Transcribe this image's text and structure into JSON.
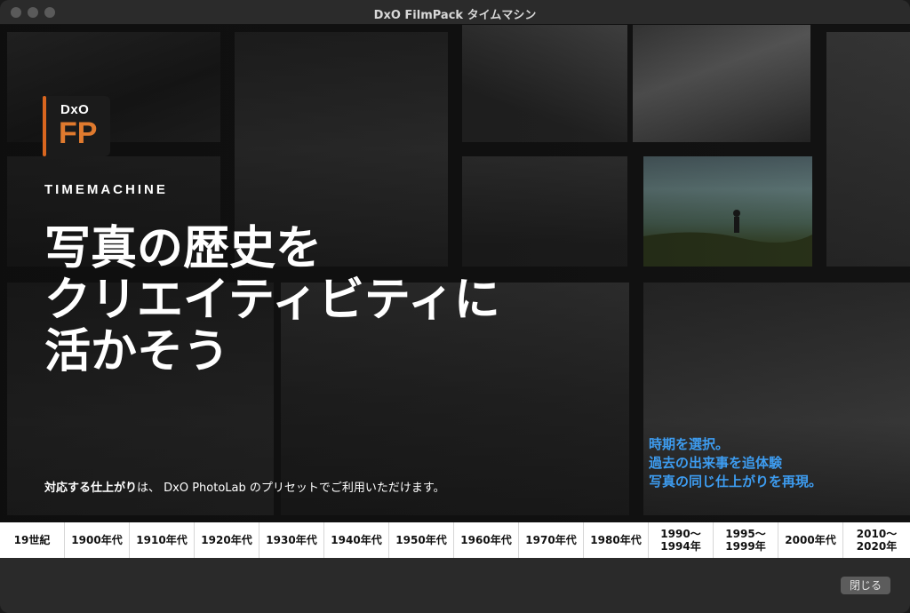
{
  "window": {
    "title": "DxO FilmPack タイムマシン"
  },
  "logo": {
    "top": "DxO",
    "main": "FP"
  },
  "hero": {
    "label": "TIMEMACHINE",
    "headline": [
      "写真の歴史を",
      "クリエイティビティに",
      "活かそう"
    ],
    "note_bold": "対応する仕上がり",
    "note_rest": "は、 DxO PhotoLab のプリセットでご利用いただけます。",
    "promo": [
      "時期を選択。",
      "過去の出来事を追体験",
      "写真の同じ仕上がりを再現。"
    ],
    "promo_color": "#3d9cf0",
    "accent_color": "#e07a2e"
  },
  "timeline": [
    {
      "label": "19世紀"
    },
    {
      "label": "1900年代"
    },
    {
      "label": "1910年代"
    },
    {
      "label": "1920年代"
    },
    {
      "label": "1930年代"
    },
    {
      "label": "1940年代"
    },
    {
      "label": "1950年代"
    },
    {
      "label": "1960年代"
    },
    {
      "label": "1970年代"
    },
    {
      "label": "1980年代"
    },
    {
      "label": "1990～\n1994年"
    },
    {
      "label": "1995～\n1999年"
    },
    {
      "label": "2000年代"
    },
    {
      "label": "2010～\n2020年"
    }
  ],
  "footer": {
    "close_label": "閉じる"
  }
}
